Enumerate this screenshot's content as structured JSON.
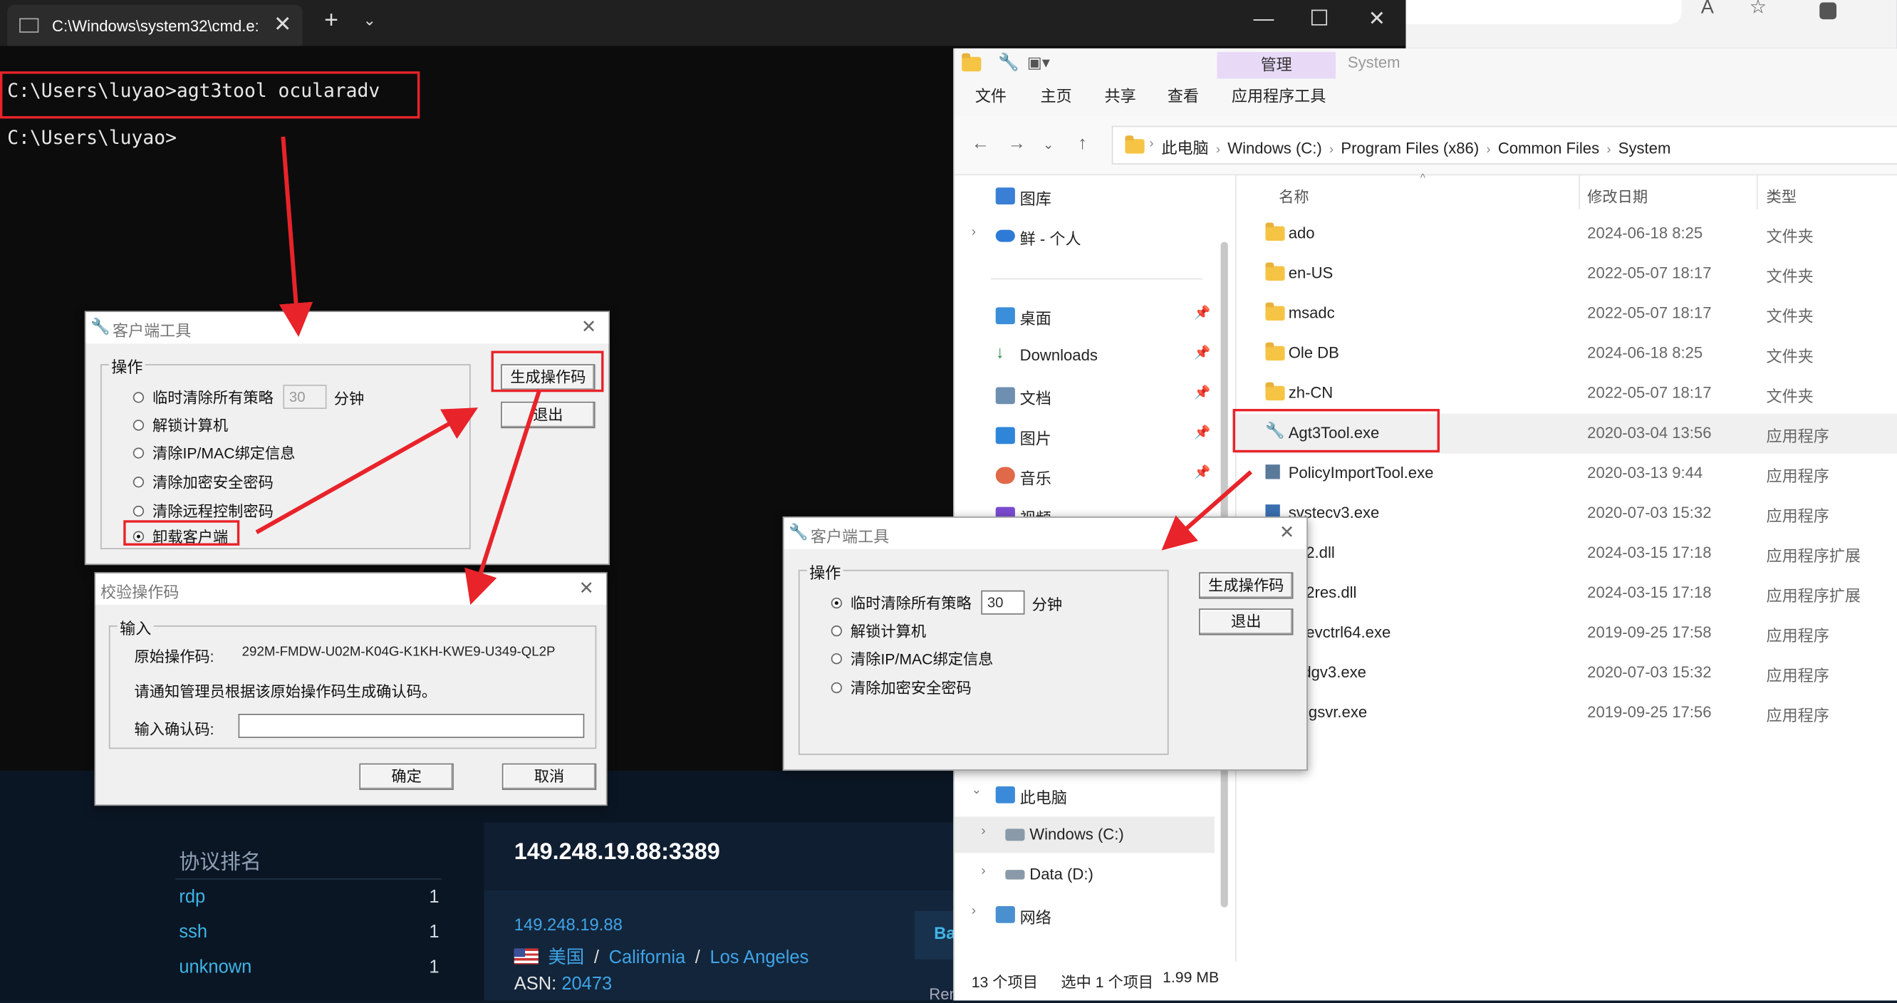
{
  "browser": {
    "icons": [
      "read-aloud-icon",
      "favorite-star-icon",
      "extension-icon"
    ]
  },
  "webpage": {
    "side_title": "协议排名",
    "protocols": [
      {
        "name": "rdp",
        "count": "1"
      },
      {
        "name": "ssh",
        "count": "1"
      },
      {
        "name": "unknown",
        "count": "1"
      }
    ],
    "ip_port": "149.248.19.88:3389",
    "ip": "149.248.19.88",
    "country": "美国",
    "region": "California",
    "city": "Los Angeles",
    "asn_label": "ASN:",
    "asn": "20473",
    "tab_partial": "Ba",
    "bottom_partial": "Remote Desktop Protocol"
  },
  "cmd": {
    "tab_title": "C:\\Windows\\system32\\cmd.e:",
    "line1": "C:\\Users\\luyao>agt3tool ocularadv",
    "line2": "C:\\Users\\luyao>"
  },
  "explorer": {
    "ribbon_context": "管理",
    "ribbon_context_sub": "System",
    "menu": [
      "文件",
      "主页",
      "共享",
      "查看",
      "应用程序工具"
    ],
    "breadcrumbs": [
      "此电脑",
      "Windows (C:)",
      "Program Files (x86)",
      "Common Files",
      "System"
    ],
    "nav": [
      {
        "label": "图库",
        "icon": "gallery-icon"
      },
      {
        "label": "鲜 - 个人",
        "icon": "onedrive-icon"
      },
      {
        "label": "桌面",
        "icon": "desktop-icon"
      },
      {
        "label": "Downloads",
        "icon": "download-icon"
      },
      {
        "label": "文档",
        "icon": "documents-icon"
      },
      {
        "label": "图片",
        "icon": "pictures-icon"
      },
      {
        "label": "音乐",
        "icon": "music-icon"
      },
      {
        "label": "视频",
        "icon": "video-icon"
      },
      {
        "label": "此电脑",
        "icon": "this-pc-icon"
      },
      {
        "label": "Windows (C:)",
        "icon": "drive-c-icon"
      },
      {
        "label": "Data (D:)",
        "icon": "drive-d-icon"
      },
      {
        "label": "网络",
        "icon": "network-icon"
      }
    ],
    "columns": {
      "name": "名称",
      "date": "修改日期",
      "type": "类型"
    },
    "files": [
      {
        "name": "ado",
        "date": "2024-06-18 8:25",
        "type": "文件夹"
      },
      {
        "name": "en-US",
        "date": "2022-05-07 18:17",
        "type": "文件夹"
      },
      {
        "name": "msadc",
        "date": "2022-05-07 18:17",
        "type": "文件夹"
      },
      {
        "name": "Ole DB",
        "date": "2024-06-18 8:25",
        "type": "文件夹"
      },
      {
        "name": "zh-CN",
        "date": "2022-05-07 18:17",
        "type": "文件夹"
      },
      {
        "name": "Agt3Tool.exe",
        "date": "2020-03-04 13:56",
        "type": "应用程序"
      },
      {
        "name": "PolicyImportTool.exe",
        "date": "2020-03-13 9:44",
        "type": "应用程序"
      },
      {
        "name": "svstecv3.exe",
        "date": "2020-07-03 15:32",
        "type": "应用程序"
      },
      {
        "name": "b32.dll",
        "date": "2024-03-15 17:18",
        "type": "应用程序扩展"
      },
      {
        "name": "b32res.dll",
        "date": "2024-03-15 17:18",
        "type": "应用程序扩展"
      },
      {
        "name": "ndevctrl64.exe",
        "date": "2019-09-25 17:58",
        "type": "应用程序"
      },
      {
        "name": "ardgv3.exe",
        "date": "2020-07-03 15:32",
        "type": "应用程序"
      },
      {
        "name": "wdgsvr.exe",
        "date": "2019-09-25 17:56",
        "type": "应用程序"
      }
    ],
    "status_count": "13 个项目",
    "status_selected": "选中 1 个项目",
    "status_size": "1.99 MB"
  },
  "dialog_client_left": {
    "title": "客户端工具",
    "group": "操作",
    "options": [
      "临时清除所有策略",
      "解锁计算机",
      "清除IP/MAC绑定信息",
      "清除加密安全密码",
      "清除远程控制密码",
      "卸载客户端"
    ],
    "minutes_value": "30",
    "minutes_unit": "分钟",
    "gen_button": "生成操作码",
    "exit_button": "退出"
  },
  "dialog_verify": {
    "title": "校验操作码",
    "group": "输入",
    "orig_label": "原始操作码:",
    "orig_code": "292M-FMDW-U02M-K04G-K1KH-KWE9-U349-QL2P",
    "notice": "请通知管理员根据该原始操作码生成确认码。",
    "confirm_label": "输入确认码:",
    "confirm_value": "",
    "ok_button": "确定",
    "cancel_button": "取消"
  },
  "dialog_client_right": {
    "title": "客户端工具",
    "group": "操作",
    "options": [
      "临时清除所有策略",
      "解锁计算机",
      "清除IP/MAC绑定信息",
      "清除加密安全密码"
    ],
    "minutes_value": "30",
    "minutes_unit": "分钟",
    "gen_button": "生成操作码",
    "exit_button": "退出"
  },
  "colors": {
    "annotation_red": "#e8232a",
    "terminal_bg": "#0c0c0c",
    "link_blue": "#3fa4e8"
  }
}
